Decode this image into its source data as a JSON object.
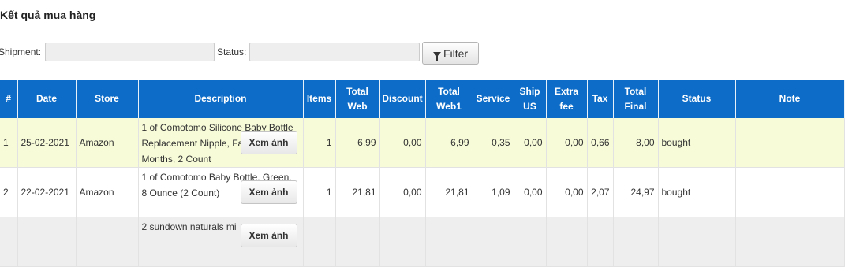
{
  "page": {
    "title": "Kết quả mua hàng"
  },
  "filters": {
    "shipment_label": "Shipment:",
    "shipment_value": "",
    "status_label": "Status:",
    "status_value": "",
    "filter_button": "Filter"
  },
  "table": {
    "headers": [
      "#",
      "Date",
      "Store",
      "Description",
      "Items",
      "Total Web",
      "Discount",
      "Total Web1",
      "Service",
      "Ship US",
      "Extra fee",
      "Tax",
      "Total Final",
      "Status",
      "Note"
    ],
    "view_button": "Xem ảnh",
    "rows": [
      {
        "index": "1",
        "date": "25-02-2021",
        "store": "Amazon",
        "description": "1 of Comotomo Silicone Baby Bottle Replacement Nipple, Fast Flow, 6+ Months, 2 Count",
        "items": "1",
        "total_web": "6,99",
        "discount": "0,00",
        "total_web1": "6,99",
        "service": "0,35",
        "ship_us": "0,00",
        "extra_fee": "0,00",
        "tax": "0,66",
        "total_final": "8,00",
        "status": "bought",
        "note": ""
      },
      {
        "index": "2",
        "date": "22-02-2021",
        "store": "Amazon",
        "description": "1 of Comotomo Baby Bottle, Green, 8 Ounce (2 Count)",
        "items": "1",
        "total_web": "21,81",
        "discount": "0,00",
        "total_web1": "21,81",
        "service": "1,09",
        "ship_us": "0,00",
        "extra_fee": "0,00",
        "tax": "2,07",
        "total_final": "24,97",
        "status": "bought",
        "note": ""
      },
      {
        "index": "",
        "date": "",
        "store": "",
        "description": "2 sundown naturals mi",
        "items": "",
        "total_web": "",
        "discount": "",
        "total_web1": "",
        "service": "",
        "ship_us": "",
        "extra_fee": "",
        "tax": "",
        "total_final": "",
        "status": "",
        "note": ""
      }
    ]
  }
}
